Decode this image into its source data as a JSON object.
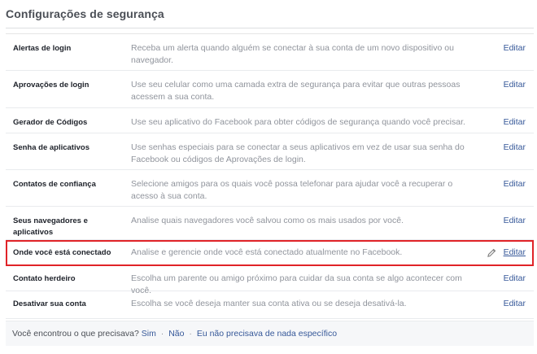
{
  "page": {
    "title": "Configurações de segurança"
  },
  "rows": [
    {
      "label": "Alertas de login",
      "description": "Receba um alerta quando alguém se conectar à sua conta de um novo dispositivo ou navegador.",
      "action": "Editar"
    },
    {
      "label": "Aprovações de login",
      "description": "Use seu celular como uma camada extra de segurança para evitar que outras pessoas acessem a sua conta.",
      "action": "Editar"
    },
    {
      "label": "Gerador de Códigos",
      "description": "Use seu aplicativo do Facebook para obter códigos de segurança quando você precisar.",
      "action": "Editar"
    },
    {
      "label": "Senha de aplicativos",
      "description": "Use senhas especiais para se conectar a seus aplicativos em vez de usar sua senha do Facebook ou códigos de Aprovações de login.",
      "action": "Editar"
    },
    {
      "label": "Contatos de confiança",
      "description": "Selecione amigos para os quais você possa telefonar para ajudar você a recuperar o acesso à sua conta.",
      "action": "Editar"
    },
    {
      "label": "Seus navegadores e aplicativos",
      "description": "Analise quais navegadores você salvou como os mais usados por você.",
      "action": "Editar"
    },
    {
      "label": "Onde você está conectado",
      "description": "Analise e gerencie onde você está conectado atualmente no Facebook.",
      "action": "Editar",
      "highlighted": true
    },
    {
      "label": "Contato herdeiro",
      "description": "Escolha um parente ou amigo próximo para cuidar da sua conta se algo acontecer com você.",
      "action": "Editar"
    },
    {
      "label": "Desativar sua conta",
      "description": "Escolha se você deseja manter sua conta ativa ou se deseja desativá-la.",
      "action": "Editar"
    }
  ],
  "footer": {
    "question": "Você encontrou o que precisava?",
    "yes": "Sim",
    "no": "Não",
    "not_specific": "Eu não precisava de nada específico",
    "separator": "·"
  },
  "colors": {
    "highlight_border": "#e02328",
    "link": "#365899",
    "description": "#90949c"
  }
}
